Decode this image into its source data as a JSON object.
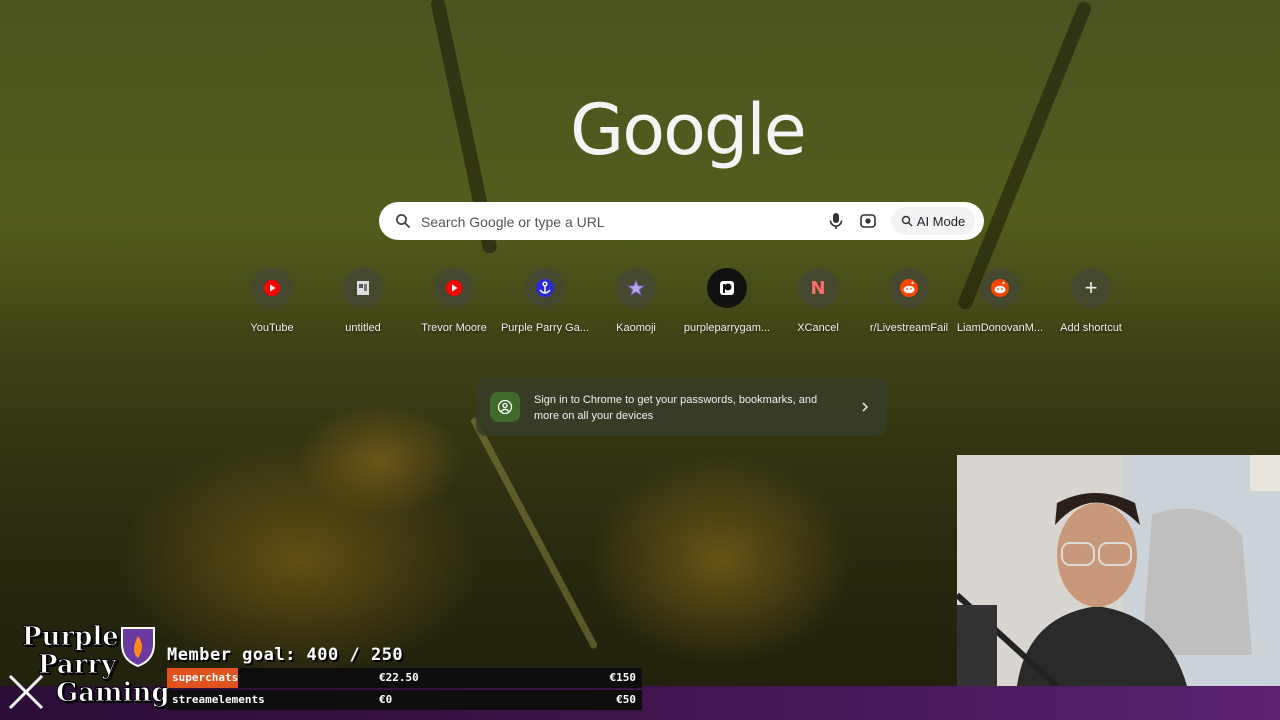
{
  "page": {
    "logo_text": "Google",
    "search": {
      "placeholder": "Search Google or type a URL",
      "ai_mode_label": "AI Mode"
    },
    "shortcuts": [
      {
        "label": "YouTube",
        "icon": "youtube-icon"
      },
      {
        "label": "untitled",
        "icon": "document-icon"
      },
      {
        "label": "Trevor Moore",
        "icon": "youtube-icon"
      },
      {
        "label": "Purple Parry Ga...",
        "icon": "anchor-icon"
      },
      {
        "label": "Kaomoji",
        "icon": "star-icon"
      },
      {
        "label": "purpleparrygam...",
        "icon": "patreon-icon"
      },
      {
        "label": "XCancel",
        "icon": "nitter-icon"
      },
      {
        "label": "r/LivestreamFail",
        "icon": "reddit-icon"
      },
      {
        "label": "LiamDonovanM...",
        "icon": "reddit-icon"
      },
      {
        "label": "Add shortcut",
        "icon": "plus-icon"
      }
    ],
    "signin_prompt": "Sign in to Chrome to get your passwords, bookmarks, and more on all your devices"
  },
  "overlay": {
    "brand": [
      "Purple",
      "Parry",
      "Gaming"
    ],
    "member_goal": "Member goal: 400 / 250",
    "goals": [
      {
        "label": "superchats",
        "current": "€22.50",
        "target": "€150",
        "progress": 0.15
      },
      {
        "label": "streamelements",
        "current": "€0",
        "target": "€50",
        "progress": 0
      }
    ]
  },
  "colors": {
    "accent_orange": "#e0521e",
    "bar_purple": "#4a1a5a",
    "youtube_red": "#ff0000",
    "reddit_orange": "#ff4500",
    "signin_green": "#3f6a2b"
  }
}
